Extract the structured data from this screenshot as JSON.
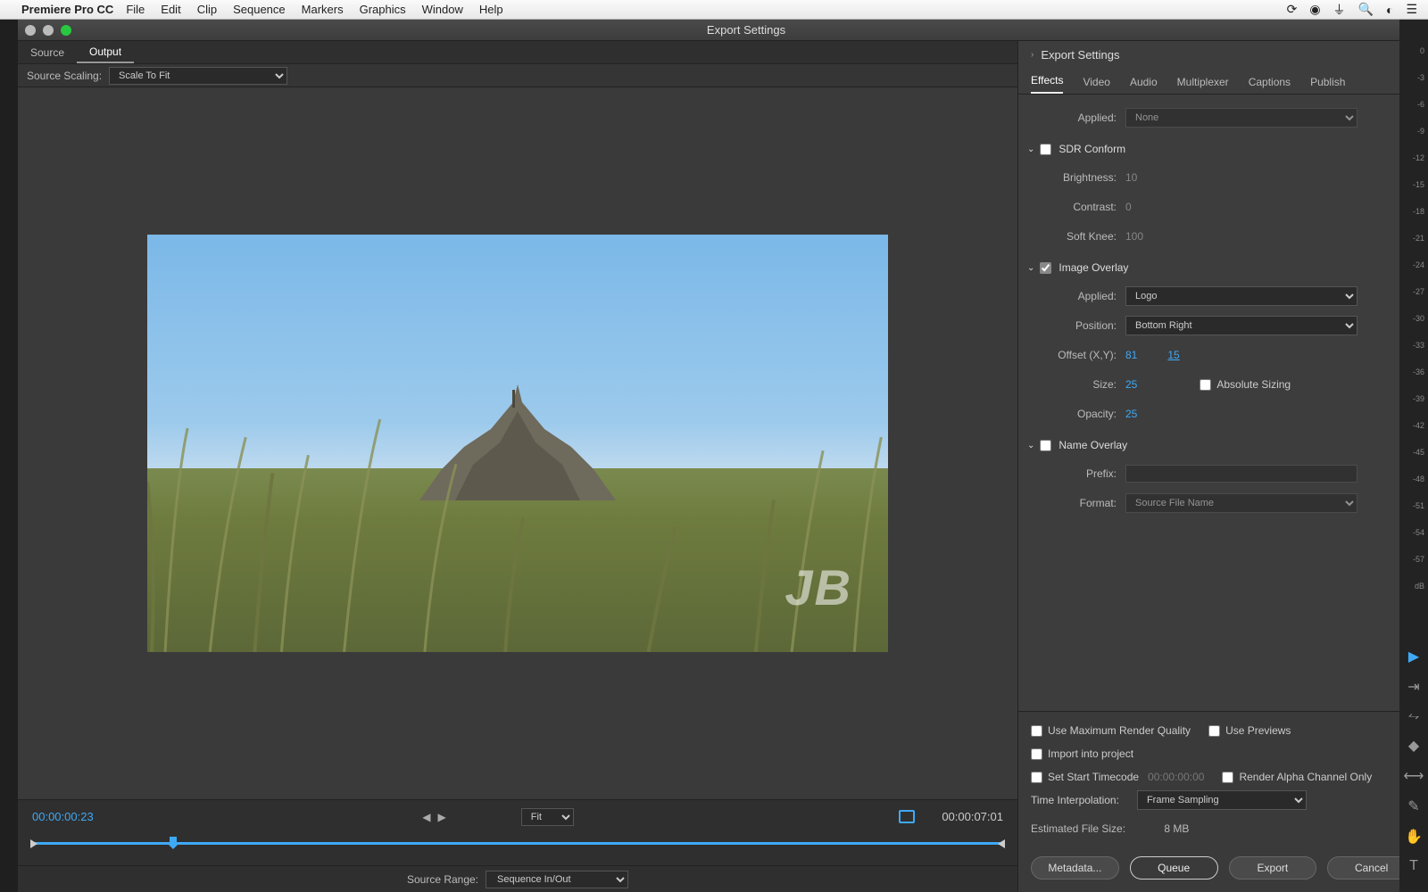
{
  "mac_menu": {
    "app": "Premiere Pro CC",
    "items": [
      "File",
      "Edit",
      "Clip",
      "Sequence",
      "Markers",
      "Graphics",
      "Window",
      "Help"
    ]
  },
  "window_title": "Export Settings",
  "source_output": {
    "source": "Source",
    "output": "Output"
  },
  "source_scaling_label": "Source Scaling:",
  "source_scaling_value": "Scale To Fit",
  "watermark": "JB",
  "transport": {
    "tc_in": "00:00:00:23",
    "tc_out": "00:00:07:01",
    "fit": "Fit"
  },
  "source_range_label": "Source Range:",
  "source_range_value": "Sequence In/Out",
  "export_settings_header": "Export Settings",
  "tabs": [
    "Effects",
    "Video",
    "Audio",
    "Multiplexer",
    "Captions",
    "Publish"
  ],
  "applied_label": "Applied:",
  "applied_none": "None",
  "sdr": {
    "title": "SDR Conform",
    "brightness_label": "Brightness:",
    "brightness": "10",
    "contrast_label": "Contrast:",
    "contrast": "0",
    "softknee_label": "Soft Knee:",
    "softknee": "100"
  },
  "img_overlay": {
    "title": "Image Overlay",
    "applied_label": "Applied:",
    "applied": "Logo",
    "position_label": "Position:",
    "position": "Bottom Right",
    "offset_label": "Offset (X,Y):",
    "offset_x": "81",
    "offset_y": "15",
    "size_label": "Size:",
    "size": "25",
    "absolute": "Absolute Sizing",
    "opacity_label": "Opacity:",
    "opacity": "25"
  },
  "name_overlay": {
    "title": "Name Overlay",
    "prefix_label": "Prefix:",
    "format_label": "Format:",
    "format": "Source File Name"
  },
  "bottom": {
    "max_quality": "Use Maximum Render Quality",
    "use_previews": "Use Previews",
    "import_project": "Import into project",
    "set_start_tc": "Set Start Timecode",
    "set_start_tc_val": "00:00:00:00",
    "render_alpha": "Render Alpha Channel Only",
    "time_interp_label": "Time Interpolation:",
    "time_interp": "Frame Sampling",
    "est_label": "Estimated File Size:",
    "est_value": "8 MB"
  },
  "buttons": {
    "metadata": "Metadata...",
    "queue": "Queue",
    "export": "Export",
    "cancel": "Cancel"
  },
  "db_ticks": [
    "0",
    "-3",
    "-6",
    "-9",
    "-12",
    "-15",
    "-18",
    "-21",
    "-24",
    "-27",
    "-30",
    "-33",
    "-36",
    "-39",
    "-42",
    "-45",
    "-48",
    "-51",
    "-54",
    "-57",
    "dB"
  ]
}
